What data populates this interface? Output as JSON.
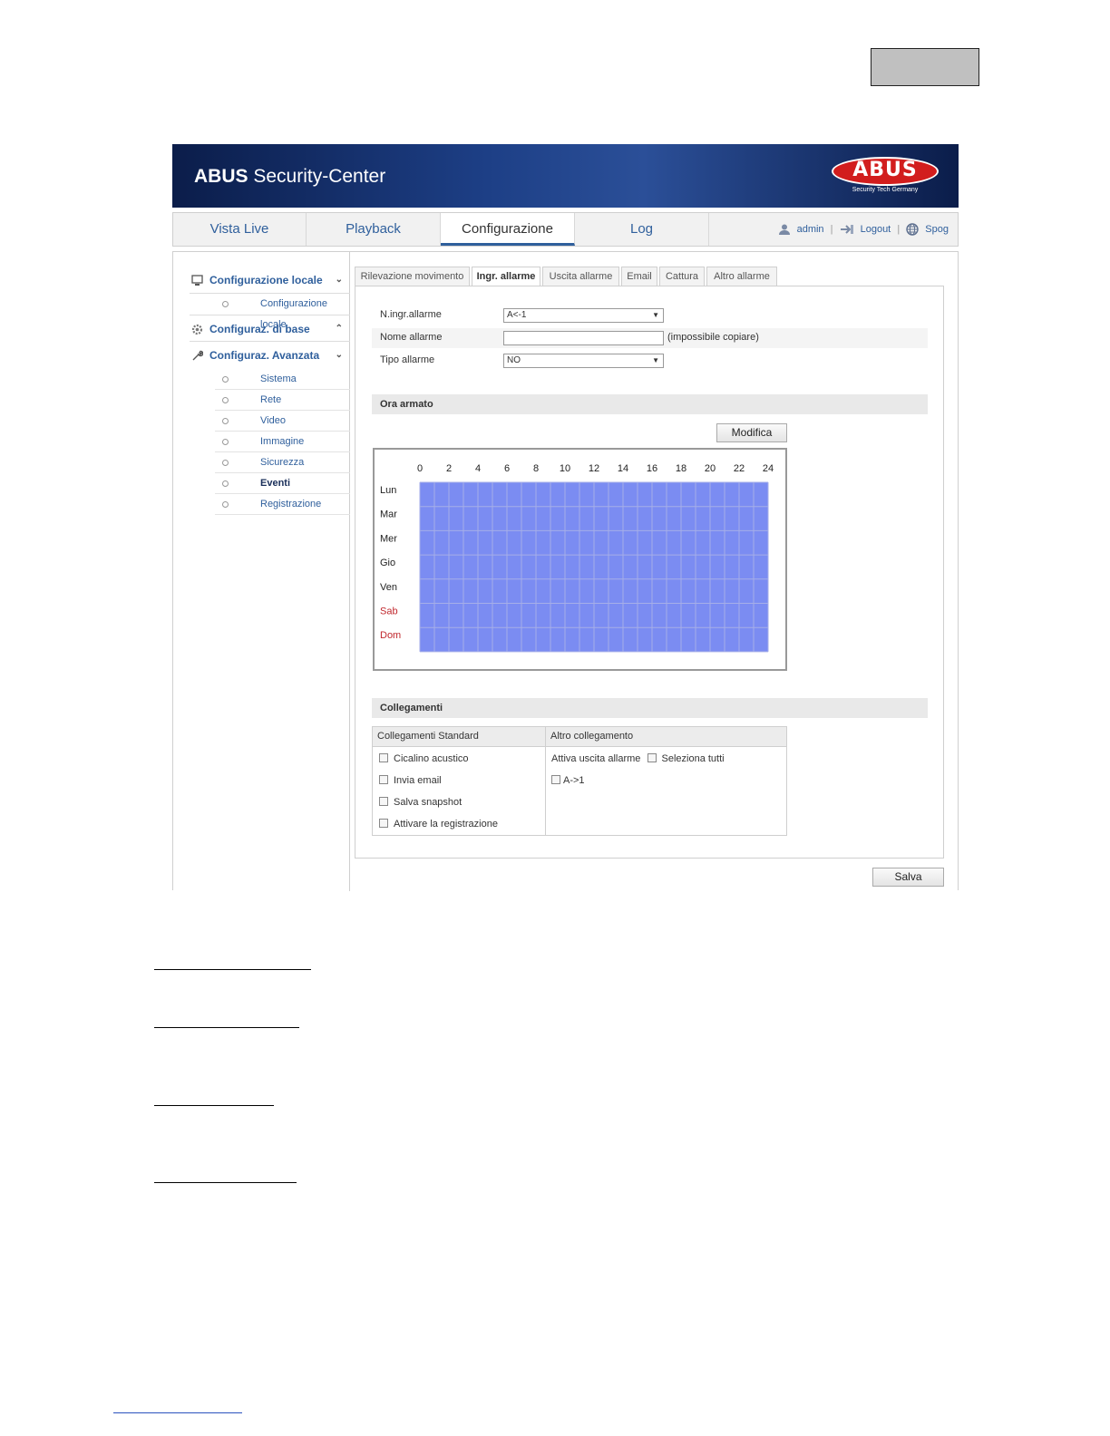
{
  "app": {
    "brand_bold": "ABUS",
    "brand_rest": " Security-Center",
    "logo_text": "ABUS",
    "logo_sub": "Security Tech Germany"
  },
  "nav": {
    "tabs": [
      "Vista Live",
      "Playback",
      "Configurazione",
      "Log"
    ],
    "active_tab": "Configurazione",
    "user": "admin",
    "logout": "Logout",
    "language": "Spog"
  },
  "sidebar": {
    "groups": [
      {
        "label": "Configurazione locale",
        "items": [
          "Configurazione locale"
        ]
      },
      {
        "label": "Configuraz. di base",
        "items": []
      },
      {
        "label": "Configuraz. Avanzata",
        "items": [
          "Sistema",
          "Rete",
          "Video",
          "Immagine",
          "Sicurezza",
          "Eventi",
          "Registrazione"
        ]
      }
    ],
    "selected_item": "Eventi"
  },
  "subtabs": [
    "Rilevazione movimento",
    "Ingr. allarme",
    "Uscita allarme",
    "Email",
    "Cattura",
    "Altro allarme"
  ],
  "active_subtab": "Ingr. allarme",
  "form": {
    "input_no_label": "N.ingr.allarme",
    "input_no_value": "A<-1",
    "name_label": "Nome allarme",
    "name_value": "",
    "name_note": "(impossibile copiare)",
    "type_label": "Tipo allarme",
    "type_value": "NO"
  },
  "schedule": {
    "section_title": "Ora armato",
    "edit_button": "Modifica",
    "hours": [
      "0",
      "2",
      "4",
      "6",
      "8",
      "10",
      "12",
      "14",
      "16",
      "18",
      "20",
      "22",
      "24"
    ],
    "days": [
      "Lun",
      "Mar",
      "Mer",
      "Gio",
      "Ven",
      "Sab",
      "Dom"
    ],
    "weekend_color": "#c0272d",
    "fill_color": "#7b8cf2",
    "armed_fraction": 1.0
  },
  "linkage": {
    "section_title": "Collegamenti",
    "standard_header": "Collegamenti Standard",
    "standard_items": [
      "Cicalino acustico",
      "Invia email",
      "Salva snapshot",
      "Attivare la registrazione"
    ],
    "other_header": "Altro collegamento",
    "trigger_label": "Attiva uscita allarme",
    "select_all": "Seleziona tutti",
    "output_item": "A->1"
  },
  "save_button": "Salva"
}
